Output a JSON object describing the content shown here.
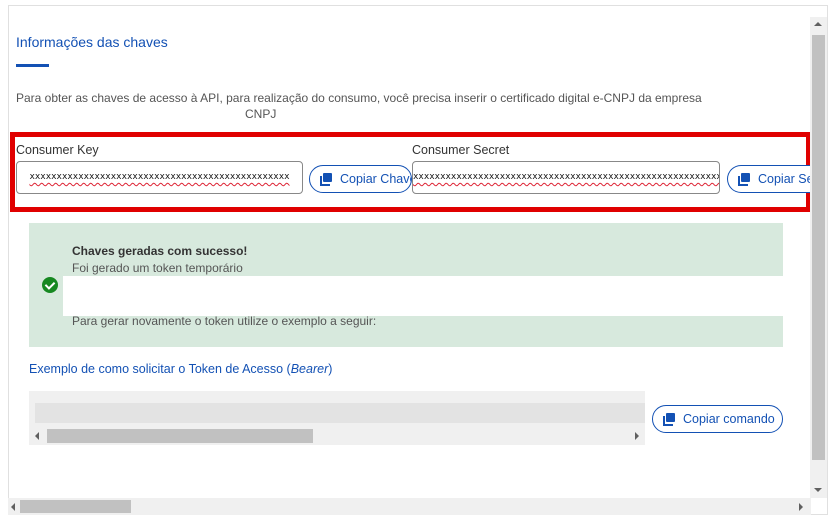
{
  "section": {
    "title": "Informações das chaves",
    "intro_line1": "Para obter as chaves de acesso à API, para realização do consumo, você precisa inserir o certificado digital e-CNPJ da empresa",
    "intro_line2": "CNPJ"
  },
  "consumer_key": {
    "label": "Consumer Key",
    "value": "xxxxxxxxxxxxxxxxxxxxxxxxxxxxxxxxxxxxxxxxxxxxxxxx",
    "copy_label": "Copiar Chave"
  },
  "consumer_secret": {
    "label": "Consumer Secret",
    "value": "xxxxxxxxxxxxxxxxxxxxxxxxxxxxxxxxxxxxxxxxxxxxxxxxxxxxxxxxx",
    "copy_label": "Copiar Se"
  },
  "alert": {
    "title": "Chaves geradas com sucesso!",
    "text": "Foi gerado um token temporário",
    "text2": "Para gerar novamente o token utilize o exemplo a seguir:",
    "status_color": "#168821",
    "icon": "check-circle-icon"
  },
  "example": {
    "title_prefix": "Exemplo de como solicitar o Token de Acesso (",
    "title_em": "Bearer",
    "title_suffix": ")",
    "copy_label": "Copiar comando"
  },
  "colors": {
    "accent": "#1351b4",
    "highlight": "#e00000",
    "alert_bg": "#d7e9dd"
  }
}
